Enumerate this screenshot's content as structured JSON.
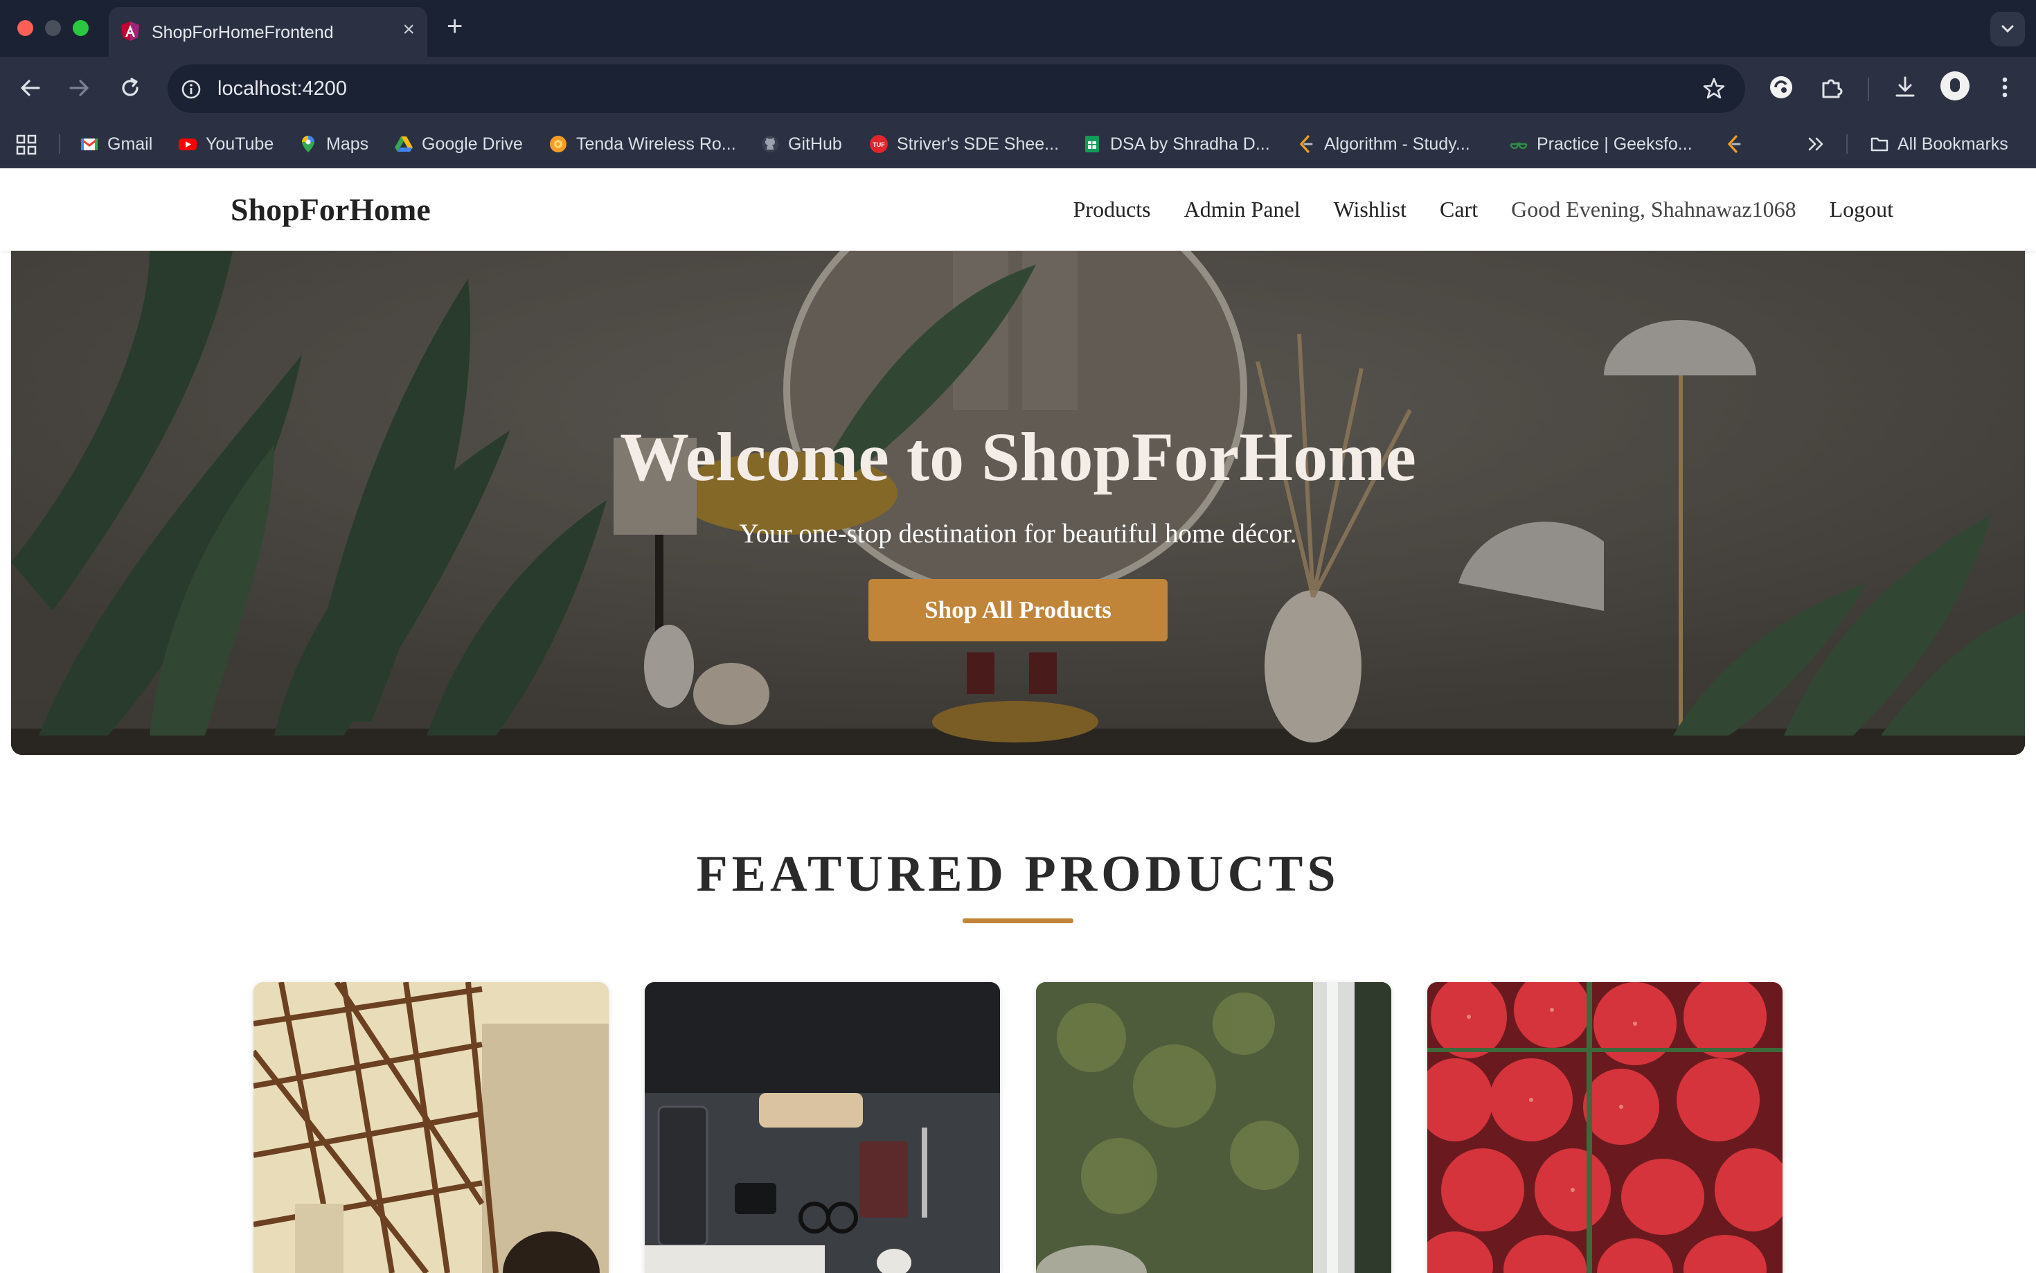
{
  "browser": {
    "tab_title": "ShopForHomeFrontend",
    "url": "localhost:4200",
    "bookmarks": [
      {
        "label": "Gmail",
        "icon": "gmail-icon"
      },
      {
        "label": "YouTube",
        "icon": "youtube-icon"
      },
      {
        "label": "Maps",
        "icon": "maps-icon"
      },
      {
        "label": "Google Drive",
        "icon": "google-drive-icon"
      },
      {
        "label": "Tenda Wireless Ro...",
        "icon": "tenda-icon"
      },
      {
        "label": "GitHub",
        "icon": "github-icon"
      },
      {
        "label": "Striver's SDE Shee...",
        "icon": "tuf-icon"
      },
      {
        "label": "DSA by Shradha D...",
        "icon": "sheets-icon"
      },
      {
        "label": "Algorithm - Study...",
        "icon": "leetcode-icon"
      },
      {
        "label": "Practice | Geeksfo...",
        "icon": "gfg-icon"
      }
    ],
    "all_bookmarks": "All Bookmarks"
  },
  "site": {
    "brand": "ShopForHome",
    "nav": {
      "products": "Products",
      "admin": "Admin Panel",
      "wishlist": "Wishlist",
      "cart": "Cart",
      "greeting": "Good Evening, Shahnawaz1068",
      "logout": "Logout"
    }
  },
  "hero": {
    "title": "Welcome to ShopForHome",
    "subtitle": "Your one-stop destination for beautiful home décor.",
    "cta": "Shop All Products"
  },
  "featured": {
    "title": "FEATURED PRODUCTS",
    "accent_color": "#c1853a"
  }
}
